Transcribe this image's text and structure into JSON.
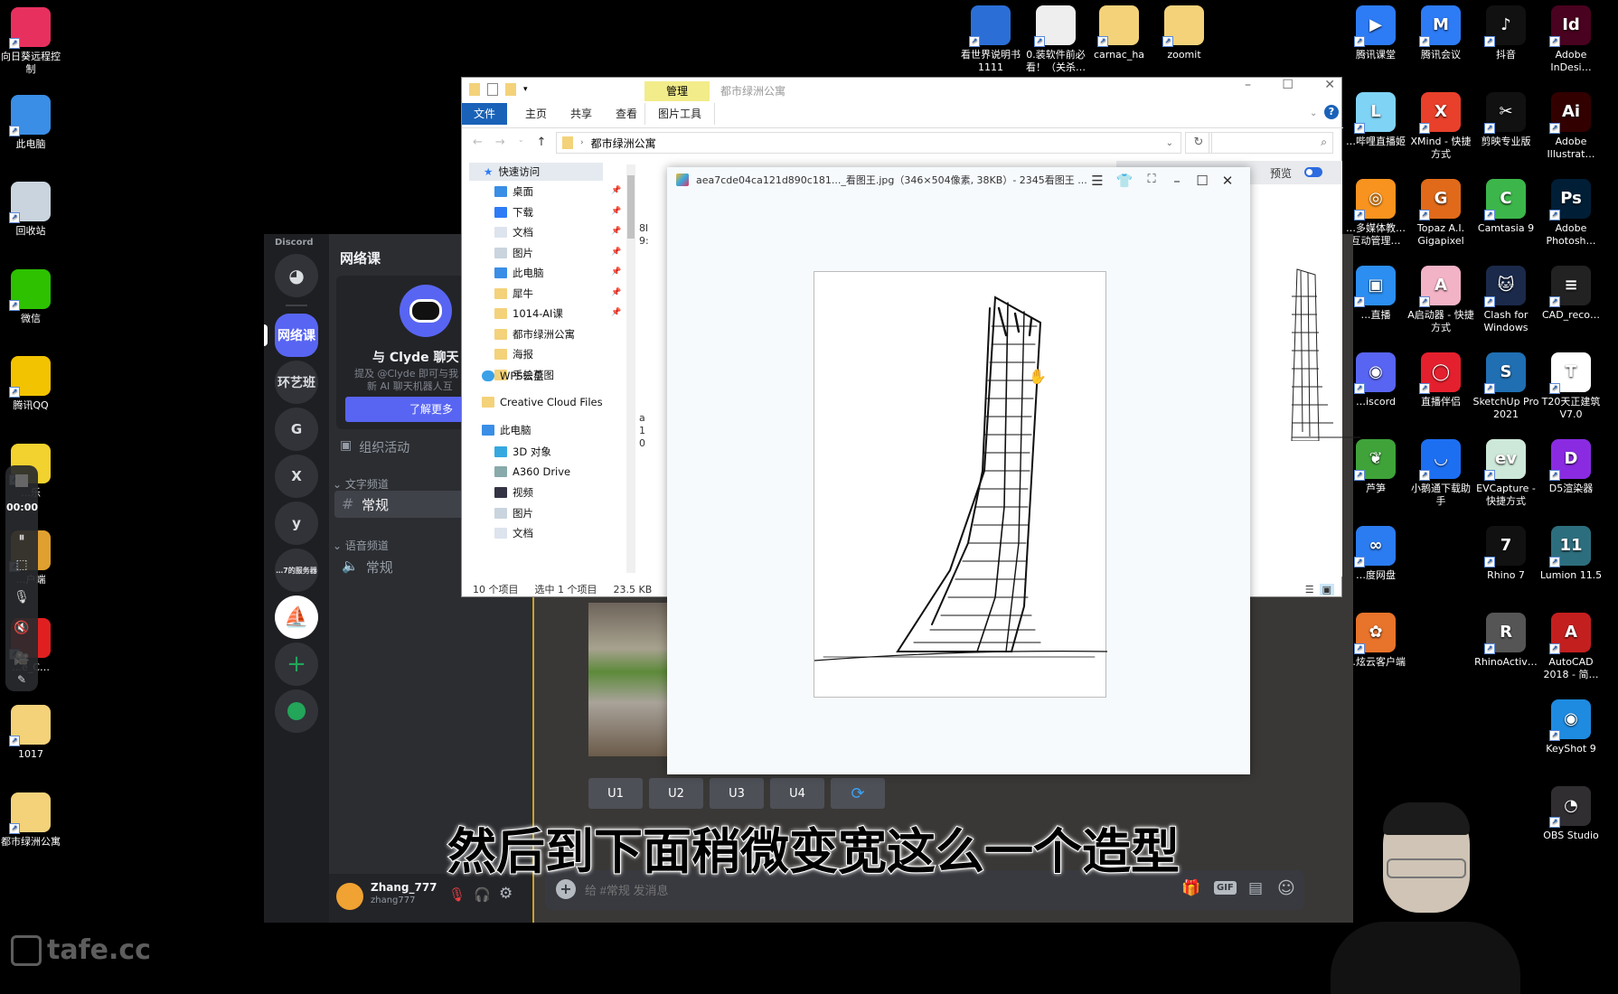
{
  "desktop": {
    "left_icons": [
      {
        "label": "向日葵远程控制",
        "icon": "sunlogin-icon",
        "color": "#e8305f"
      },
      {
        "label": "此电脑",
        "icon": "computer-icon",
        "color": "#3a8ee6"
      },
      {
        "label": "回收站",
        "icon": "recycle-bin-icon",
        "color": "#c9d4de"
      },
      {
        "label": "微信",
        "icon": "wechat-icon",
        "color": "#2dc100"
      },
      {
        "label": "腾讯QQ",
        "icon": "qq-icon",
        "color": "#f2c300"
      },
      {
        "label": "…乐",
        "icon": "music-icon",
        "color": "#f2d22e"
      },
      {
        "label": "…户端",
        "icon": "client-icon",
        "color": "#e0a030"
      },
      {
        "label": "…e_C…",
        "icon": "app-icon",
        "color": "#e02020"
      },
      {
        "label": "1017",
        "icon": "folder-icon",
        "color": "#f3d27a"
      },
      {
        "label": "都市绿洲公寓",
        "icon": "folder-icon",
        "color": "#f3d27a"
      }
    ],
    "top_icons": [
      {
        "label": "看世界说明书 1111",
        "icon": "word-doc-icon",
        "color": "#2b6fd6"
      },
      {
        "label": "0.装软件前必看！（关杀…",
        "icon": "text-file-icon",
        "color": "#eeeeee"
      },
      {
        "label": "carnac_ha",
        "icon": "folder-icon",
        "color": "#f3d27a"
      },
      {
        "label": "zoomit",
        "icon": "folder-icon",
        "color": "#f3d27a"
      }
    ],
    "right_icons": [
      {
        "label": "腾讯课堂",
        "icon": "tencent-class-icon",
        "color": "#2d7cf6",
        "glyph": "▶"
      },
      {
        "label": "腾讯会议",
        "icon": "tencent-meeting-icon",
        "color": "#2d7cf6",
        "glyph": "M"
      },
      {
        "label": "抖音",
        "icon": "douyin-icon",
        "color": "#111111",
        "glyph": "♪"
      },
      {
        "label": "Adobe InDesi…",
        "icon": "indesign-icon",
        "color": "#49021f",
        "glyph": "Id"
      },
      {
        "label": "…哔哩直播姬",
        "icon": "bilibili-live-icon",
        "color": "#7fd3f5",
        "glyph": "L"
      },
      {
        "label": "XMind - 快捷方式",
        "icon": "xmind-icon",
        "color": "#e8402a",
        "glyph": "X"
      },
      {
        "label": "剪映专业版",
        "icon": "capcut-icon",
        "color": "#111111",
        "glyph": "✂"
      },
      {
        "label": "Adobe Illustrat…",
        "icon": "illustrator-icon",
        "color": "#330000",
        "glyph": "Ai"
      },
      {
        "label": "…多媒体教…互动管理…",
        "icon": "multimedia-icon",
        "color": "#f7931e",
        "glyph": "◎"
      },
      {
        "label": "Topaz A.I. Gigapixel",
        "icon": "topaz-icon",
        "color": "#e06a1a",
        "glyph": "G"
      },
      {
        "label": "Camtasia 9",
        "icon": "camtasia-icon",
        "color": "#3cb64a",
        "glyph": "C"
      },
      {
        "label": "Adobe Photosh…",
        "icon": "photoshop-icon",
        "color": "#001e36",
        "glyph": "Ps"
      },
      {
        "label": "…直播",
        "icon": "live-icon",
        "color": "#2b8ef0",
        "glyph": "▣"
      },
      {
        "label": "A启动器 - 快捷方式",
        "icon": "launcher-icon",
        "color": "#f3b3c7",
        "glyph": "A"
      },
      {
        "label": "Clash for Windows",
        "icon": "clash-icon",
        "color": "#1b2a4a",
        "glyph": "🐱"
      },
      {
        "label": "CAD_reco…",
        "icon": "cad-reco-icon",
        "color": "#222222",
        "glyph": "≡"
      },
      {
        "label": "…iscord",
        "icon": "discord-icon",
        "color": "#5865f2",
        "glyph": "◉"
      },
      {
        "label": "直播伴侣",
        "icon": "live-companion-icon",
        "color": "#e5202e",
        "glyph": "◯"
      },
      {
        "label": "SketchUp Pro 2021",
        "icon": "sketchup-icon",
        "color": "#1f6fb2",
        "glyph": "S"
      },
      {
        "label": "T20天正建筑 V7.0",
        "icon": "t20-icon",
        "color": "#ffffff",
        "glyph": "T"
      },
      {
        "label": "芦笋",
        "icon": "lusun-icon",
        "color": "#3fa33a",
        "glyph": "❦"
      },
      {
        "label": "小鹅通下载助手",
        "icon": "xiaoetong-icon",
        "color": "#1d6ff2",
        "glyph": "◡"
      },
      {
        "label": "EVCapture - 快捷方式",
        "icon": "evcapture-icon",
        "color": "#cde8d8",
        "glyph": "ev"
      },
      {
        "label": "D5渲染器",
        "icon": "d5-render-icon",
        "color": "#8a2be2",
        "glyph": "D"
      },
      {
        "label": "…度网盘",
        "icon": "baidu-pan-icon",
        "color": "#2b7cf0",
        "glyph": "∞"
      },
      {
        "label": "",
        "icon": "",
        "color": "",
        "glyph": ""
      },
      {
        "label": "Rhino 7",
        "icon": "rhino-icon",
        "color": "#111111",
        "glyph": "7"
      },
      {
        "label": "Lumion 11.5",
        "icon": "lumion-icon",
        "color": "#2d6e7e",
        "glyph": "11"
      },
      {
        "label": "…炫云客户端",
        "icon": "xuanyun-icon",
        "color": "#e8732a",
        "glyph": "✿"
      },
      {
        "label": "",
        "icon": "",
        "color": "",
        "glyph": ""
      },
      {
        "label": "RhinoActiv…",
        "icon": "rhino-activ-icon",
        "color": "#555555",
        "glyph": "R"
      },
      {
        "label": "AutoCAD 2018 - 简…",
        "icon": "autocad-icon",
        "color": "#c41f1f",
        "glyph": "A"
      },
      {
        "label": "",
        "icon": "",
        "color": "",
        "glyph": ""
      },
      {
        "label": "",
        "icon": "",
        "color": "",
        "glyph": ""
      },
      {
        "label": "",
        "icon": "",
        "color": "",
        "glyph": ""
      },
      {
        "label": "KeyShot 9",
        "icon": "keyshot-icon",
        "color": "#1e8be0",
        "glyph": "◉"
      },
      {
        "label": "",
        "icon": "",
        "color": "",
        "glyph": ""
      },
      {
        "label": "",
        "icon": "",
        "color": "",
        "glyph": ""
      },
      {
        "label": "",
        "icon": "",
        "color": "",
        "glyph": ""
      },
      {
        "label": "OBS Studio",
        "icon": "obs-icon",
        "color": "#302e31",
        "glyph": "◔"
      }
    ],
    "watermark": "tafe.cc"
  },
  "recorder": {
    "time": "00:00"
  },
  "discord": {
    "brand": "Discord",
    "servers": [
      "网络课",
      "环艺班",
      "G",
      "X",
      "y",
      "…7的服务器"
    ],
    "server_name": "网络课",
    "clyde": {
      "title": "与 Clyde 聊天",
      "desc_line1": "提及 @Clyde 即可与我",
      "desc_line2": "新 AI 聊天机器人互",
      "button": "了解更多"
    },
    "events_label": "组织活动",
    "text_channels_header": "文字频道",
    "text_channel": "常规",
    "voice_channels_header": "语音频道",
    "voice_channel": "常规",
    "user": {
      "name": "Zhang_777",
      "tag": "zhang777"
    },
    "upscale_buttons": [
      "U1",
      "U2",
      "U3",
      "U4"
    ],
    "message_placeholder": "给 #常规 发消息",
    "gif_label": "GIF",
    "accent": "#5865f2"
  },
  "explorer": {
    "window_title": "都市绿洲公寓",
    "context_tab": "管理",
    "ribbon_tabs": [
      "文件",
      "主页",
      "共享",
      "查看",
      "图片工具"
    ],
    "address_path": "都市绿洲公寓",
    "preview_label": "预览",
    "nav": {
      "quick_access": "快速访问",
      "quick_items": [
        "桌面",
        "下载",
        "文档",
        "图片",
        "此电脑",
        "犀牛",
        "1014-AI课",
        "都市绿洲公寓",
        "海报",
        "手绘草图"
      ],
      "wps": "WPS云盘",
      "creative_cloud": "Creative Cloud Files",
      "this_pc": "此电脑",
      "pc_items": [
        "3D 对象",
        "A360 Drive",
        "视频",
        "图片",
        "文档"
      ]
    },
    "status": {
      "count": "10 个项目",
      "selected": "选中 1 个项目",
      "size": "23.5 KB"
    }
  },
  "viewer": {
    "title": "aea7cde04ca121d890c181..._看图王.jpg（346×504像素, 38KB）- 2345看图王 ..."
  },
  "subtitle": "然后到下面稍微变宽这么一个造型"
}
